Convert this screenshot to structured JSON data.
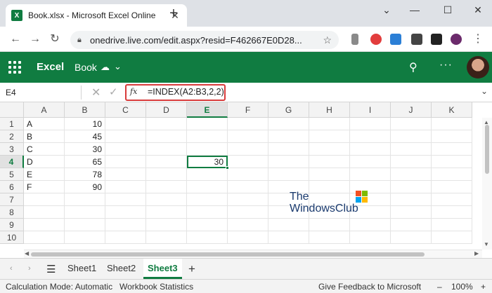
{
  "browser": {
    "tab_title": "Book.xlsx - Microsoft Excel Online",
    "tab_icon_letter": "X",
    "url": "onedrive.live.com/edit.aspx?resid=F462667E0D28..."
  },
  "excel_header": {
    "app_name": "Excel",
    "doc_name": "Book"
  },
  "formula_bar": {
    "name_box": "E4",
    "fx_label": "fx",
    "formula": "=INDEX(A2:B3,2,2)"
  },
  "grid": {
    "columns": [
      "A",
      "B",
      "C",
      "D",
      "E",
      "F",
      "G",
      "H",
      "I",
      "J",
      "K"
    ],
    "rows": [
      "1",
      "2",
      "3",
      "4",
      "5",
      "6",
      "7",
      "8",
      "9",
      "10"
    ],
    "selected_column": "E",
    "selected_row": "4",
    "col_a": [
      "A",
      "B",
      "C",
      "D",
      "E",
      "F"
    ],
    "col_b": [
      "10",
      "45",
      "30",
      "65",
      "78",
      "90"
    ],
    "e4_value": "30"
  },
  "watermark": {
    "line1": "The",
    "line2": "WindowsClub"
  },
  "sheets": {
    "tabs": [
      "Sheet1",
      "Sheet2",
      "Sheet3"
    ],
    "active": "Sheet3"
  },
  "status_bar": {
    "calc_mode": "Calculation Mode: Automatic",
    "workbook_stats": "Workbook Statistics",
    "feedback": "Give Feedback to Microsoft",
    "zoom": "100%"
  },
  "colors": {
    "excel_green": "#107c41",
    "highlight_red": "#d83b3b"
  }
}
